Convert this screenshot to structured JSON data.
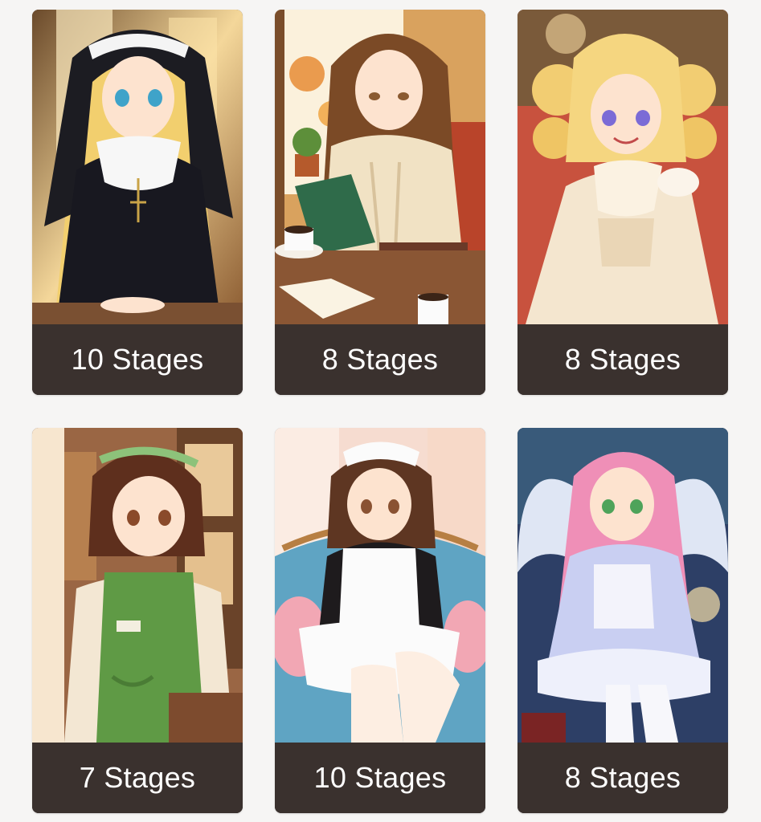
{
  "cards": [
    {
      "stages_label": "10 Stages",
      "character_image": "nun-character-illustration"
    },
    {
      "stages_label": "8 Stages",
      "character_image": "reading-cafe-character-illustration"
    },
    {
      "stages_label": "8 Stages",
      "character_image": "lace-dress-character-illustration"
    },
    {
      "stages_label": "7 Stages",
      "character_image": "cafe-apron-character-illustration"
    },
    {
      "stages_label": "10 Stages",
      "character_image": "maid-character-illustration"
    },
    {
      "stages_label": "8 Stages",
      "character_image": "angel-character-illustration"
    }
  ],
  "colors": {
    "page_background": "#f6f5f4",
    "label_bar": "#3a312e",
    "label_text": "#ffffff"
  }
}
